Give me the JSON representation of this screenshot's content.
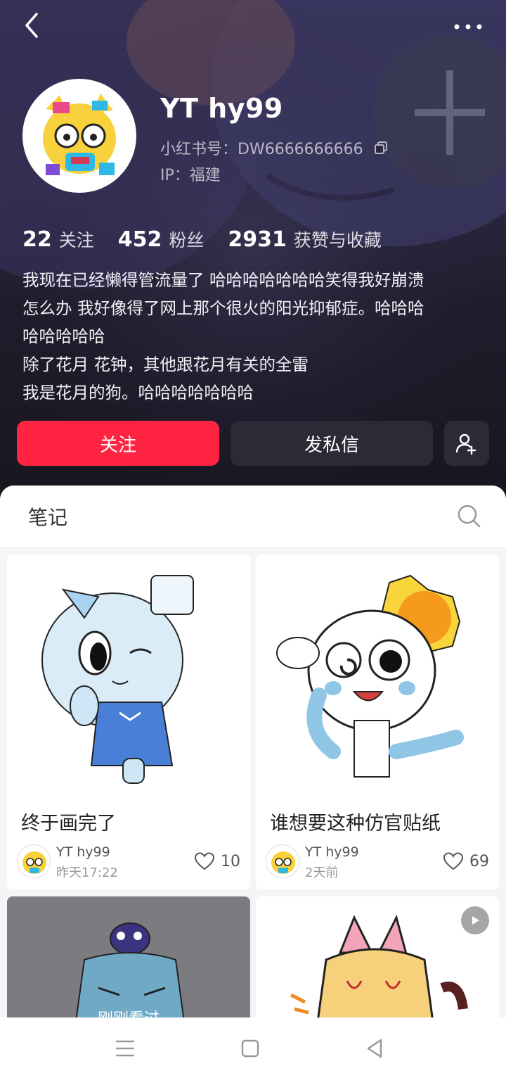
{
  "profile": {
    "username": "YT hy99",
    "user_id": "小红书号：DW6666666666",
    "ip_location": "IP：福建",
    "stats": [
      {
        "num": "22",
        "label": "关注"
      },
      {
        "num": "452",
        "label": "粉丝"
      },
      {
        "num": "2931",
        "label": "获赞与收藏"
      }
    ],
    "bio": "我现在已经懒得管流量了  哈哈哈哈哈哈哈笑得我好崩溃\n怎么办  我好像得了网上那个很火的阳光抑郁症。哈哈哈\n哈哈哈哈哈\n除了花月 花钟，其他跟花月有关的全雷\n我是花月的狗。哈哈哈哈哈哈哈"
  },
  "actions": {
    "follow_label": "关注",
    "message_label": "发私信"
  },
  "tabs": {
    "notes_label": "笔记"
  },
  "notes": [
    {
      "title": "终于画完了",
      "author": "YT hy99",
      "time": "昨天17:22",
      "likes": "10"
    },
    {
      "title": "谁想要这种仿官贴纸",
      "author": "YT hy99",
      "time": "2天前",
      "likes": "69"
    }
  ],
  "recent_label": "刚刚看过",
  "colors": {
    "brand": "#ff2442",
    "dark_button": "#2b2a36",
    "header_bg": "#2a2740"
  },
  "icons": [
    "back-arrow-icon",
    "more-icon",
    "copy-icon",
    "add-friend-icon",
    "search-icon",
    "heart-icon",
    "play-icon",
    "menu-icon",
    "home-square-icon",
    "back-triangle-icon"
  ]
}
